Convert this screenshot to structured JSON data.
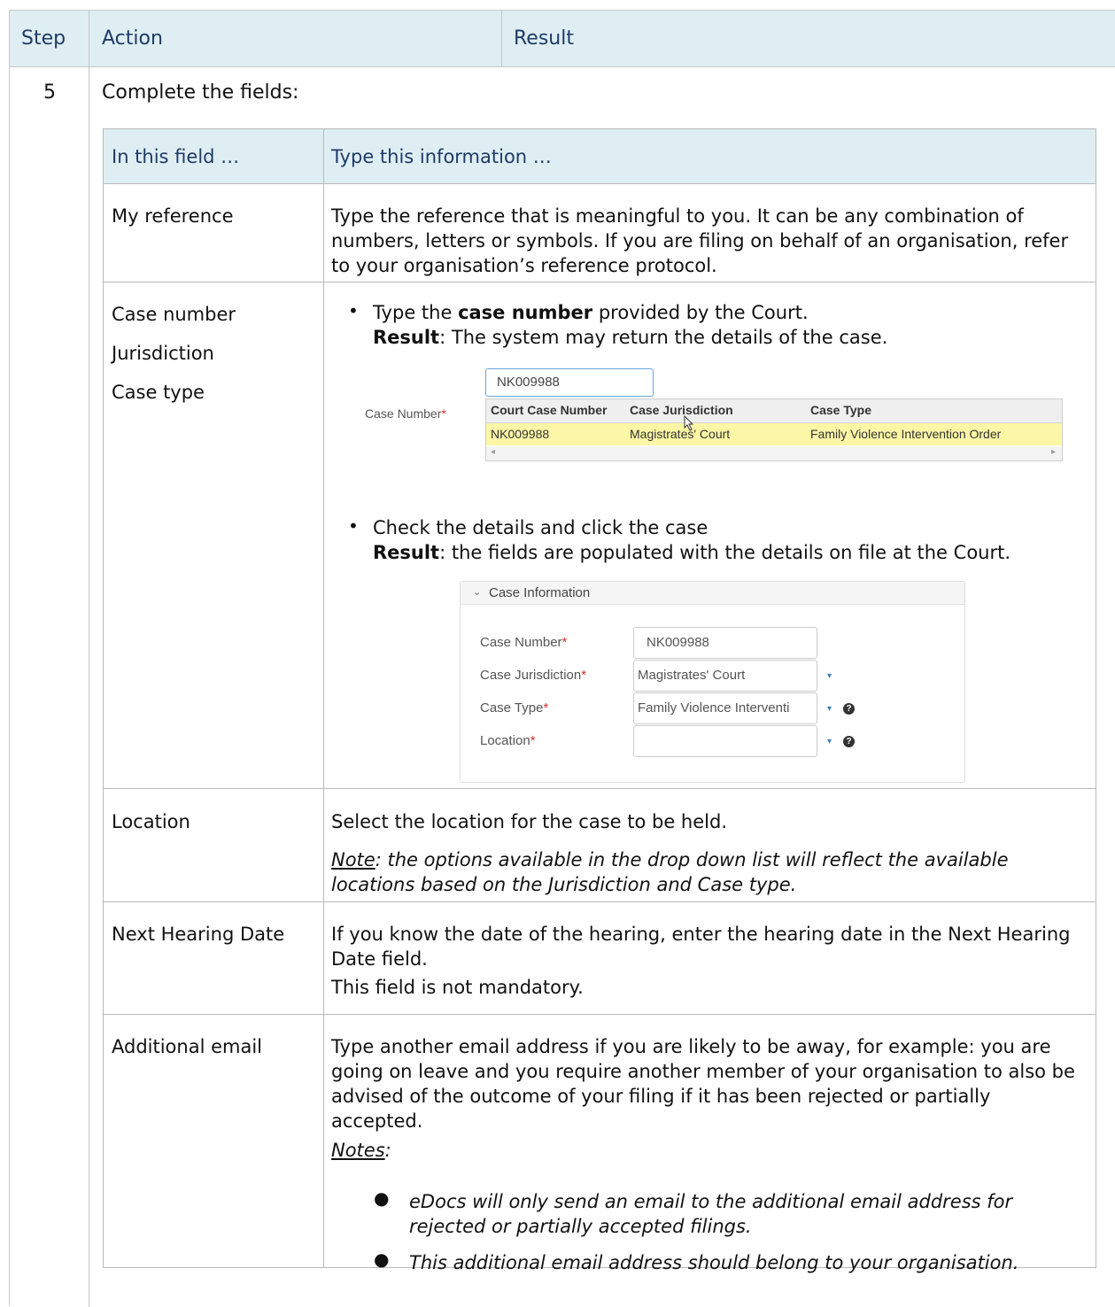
{
  "outer_table": {
    "headers": {
      "step": "Step",
      "action": "Action",
      "result": "Result"
    },
    "step_number": "5",
    "lead_text": "Complete the fields:"
  },
  "inner_table": {
    "headers": {
      "field": "In this field …",
      "info": "Type this information …"
    },
    "rows": {
      "my_reference": {
        "field": "My reference",
        "info": "Type the reference that is meaningful to you. It can be any combination of numbers, letters or symbols. If you are filing on behalf of an organisation, refer to your organisation’s reference protocol."
      },
      "case": {
        "fields": [
          "Case number",
          "Jurisdiction",
          "Case type"
        ],
        "bullet1": {
          "pre": "Type the ",
          "bold": "case number",
          "post": " provided by the Court.",
          "result_label": "Result",
          "result_text": ":  The system may return the details of the case."
        },
        "bullet2": {
          "text": "Check the details and click the case",
          "result_label": "Result",
          "result_text": ":  the fields are populated with the details on file at the Court."
        }
      },
      "location": {
        "field": "Location",
        "info": "Select the location for the case to be held.",
        "note_label": "Note",
        "note_text": ":  the options available in the drop down list will reflect the available locations based on the Jurisdiction and Case type."
      },
      "next_hearing": {
        "field": "Next Hearing Date",
        "info": "If you know the date of the hearing, enter the hearing date in the Next Hearing Date field.",
        "info2": "This field is not mandatory."
      },
      "additional_email": {
        "field": "Additional email",
        "info": "Type another email address if you are likely to be away, for example:  you are going on leave and you require another member of your organisation to also be advised of the outcome of your filing if it has been rejected or partially accepted.",
        "notes_label": "Notes",
        "notes_colon": ":",
        "notes": [
          "eDocs will only send an email to the additional email address for rejected or partially accepted filings.",
          "This additional email address should belong to your organisation."
        ]
      }
    }
  },
  "screenshot_search": {
    "label": "Case Number",
    "required_mark": "*",
    "input_value": "NK009988",
    "columns": [
      "Court Case Number",
      "Case Jurisdiction",
      "Case Type"
    ],
    "row": [
      "NK009988",
      "Magistrates' Court",
      "Family Violence Intervention Order"
    ]
  },
  "screenshot_panel": {
    "title": "Case Information",
    "required_mark": "*",
    "fields": [
      {
        "label": "Case Number",
        "value": "NK009988"
      },
      {
        "label": "Case Jurisdiction",
        "value": "Magistrates' Court"
      },
      {
        "label": "Case Type",
        "value": "Family Violence Interventi"
      },
      {
        "label": "Location",
        "value": ""
      }
    ],
    "help_glyph": "?"
  },
  "colors": {
    "header_bg": "#deeef3",
    "header_text": "#1f3b66",
    "highlight_row": "#fcf7a6",
    "required": "#d0302a"
  }
}
